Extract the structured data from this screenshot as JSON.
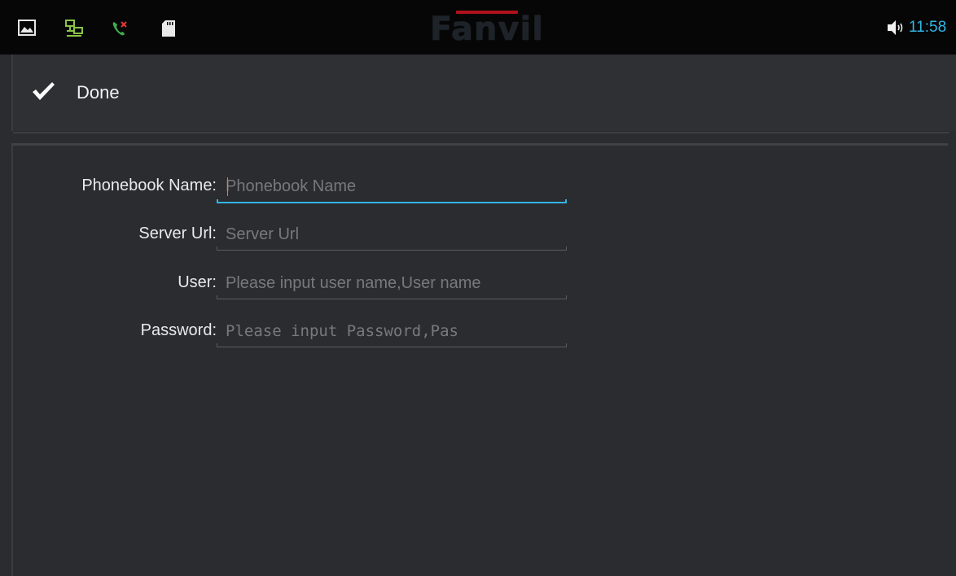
{
  "status_bar": {
    "brand": "Fanvil",
    "time": "11:58",
    "icons": [
      "image-icon",
      "network-icon",
      "missed-call-icon",
      "sd-card-icon",
      "volume-icon"
    ],
    "colors": {
      "network": "#8bc34a",
      "missed_call": "#3fae4a",
      "missed_mark": "#e53935",
      "clock": "#31b6e7"
    }
  },
  "action_bar": {
    "done_label": "Done",
    "icon": "checkmark-icon"
  },
  "form": {
    "phonebook_name": {
      "label": "Phonebook Name:",
      "placeholder": "Phonebook Name",
      "value": ""
    },
    "server_url": {
      "label": "Server Url:",
      "placeholder": "Server Url",
      "value": ""
    },
    "user": {
      "label": "User:",
      "placeholder": "Please input user name,User name",
      "value": ""
    },
    "password": {
      "label": "Password:",
      "placeholder": "Please input Password,Pas",
      "value": ""
    }
  },
  "accent_color": "#33b5e5"
}
